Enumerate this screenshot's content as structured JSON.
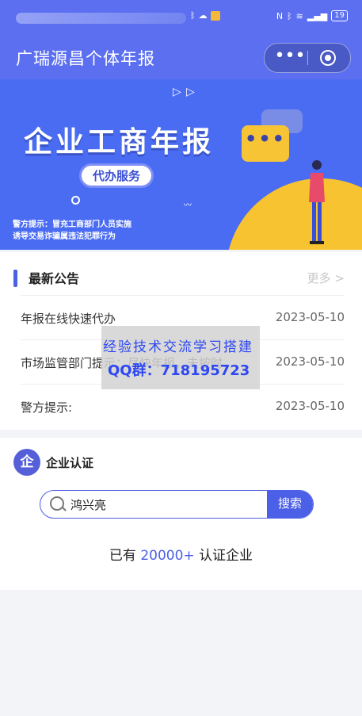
{
  "status_bar": {
    "battery": "19"
  },
  "nav": {
    "title": "广瑞源昌个体年报",
    "more_icon": "more-dots-icon",
    "close_icon": "target-icon"
  },
  "banner": {
    "headline": "企业工商年报",
    "badge": "代办服务",
    "warning_line1": "警方提示：冒充工商部门人员实施",
    "warning_line2": "诱导交易诈骗属违法犯罪行为"
  },
  "notice": {
    "title": "最新公告",
    "more": "更多 >",
    "items": [
      {
        "title": "年报在线快速代办",
        "date": "2023-05-10"
      },
      {
        "title": "市场监管部门提示：尽快年报，未按时...",
        "date": "2023-05-10"
      },
      {
        "title": "警方提示:",
        "date": "2023-05-10"
      }
    ]
  },
  "cert": {
    "logo": "企",
    "title": "企业认证",
    "search_value": "鸿兴亮",
    "search_button": "搜索",
    "stat_prefix": "已有",
    "stat_count": "20000+",
    "stat_suffix": "认证企业"
  },
  "watermark": {
    "line1": "经验技术交流学习搭建",
    "line2": "QQ群：718195723"
  },
  "colors": {
    "primary": "#4c5fe7",
    "nav_bg": "#5b6ff0",
    "banner_bg": "#4a6cf3",
    "accent_yellow": "#f8c330"
  }
}
